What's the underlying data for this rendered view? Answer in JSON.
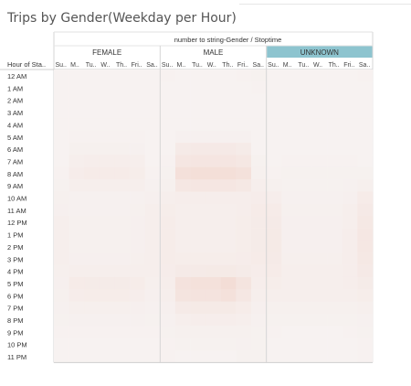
{
  "title": "Trips by Gender(Weekday per Hour)",
  "chart_data": {
    "type": "heatmap",
    "title": "Trips by Gender(Weekday per Hour)",
    "column_header": "number to string-Gender / Stoptime",
    "row_header": "Hour of Sta..",
    "groups": [
      "FEMALE",
      "MALE",
      "UNKNOWN"
    ],
    "highlighted_group": "UNKNOWN",
    "day_labels": [
      "Su..",
      "M..",
      "Tu..",
      "W..",
      "Th..",
      "Fri..",
      "Sa.."
    ],
    "hours": [
      "12 AM",
      "1 AM",
      "2 AM",
      "3 AM",
      "4 AM",
      "5 AM",
      "6 AM",
      "7 AM",
      "8 AM",
      "9 AM",
      "10 AM",
      "11 AM",
      "12 PM",
      "1 PM",
      "2 PM",
      "3 PM",
      "4 PM",
      "5 PM",
      "6 PM",
      "7 PM",
      "8 PM",
      "9 PM",
      "10 PM",
      "11 PM"
    ],
    "color_scale": {
      "low": "#f7f4f4",
      "high": "#efc3b3"
    },
    "intensity": {
      "FEMALE": [
        [
          0.05,
          0.05,
          0.05,
          0.05,
          0.05,
          0.05,
          0.05
        ],
        [
          0.04,
          0.04,
          0.04,
          0.04,
          0.04,
          0.04,
          0.04
        ],
        [
          0.04,
          0.04,
          0.04,
          0.04,
          0.04,
          0.04,
          0.04
        ],
        [
          0.04,
          0.04,
          0.04,
          0.04,
          0.04,
          0.04,
          0.04
        ],
        [
          0.04,
          0.04,
          0.04,
          0.04,
          0.04,
          0.04,
          0.04
        ],
        [
          0.04,
          0.06,
          0.06,
          0.06,
          0.06,
          0.06,
          0.04
        ],
        [
          0.04,
          0.09,
          0.09,
          0.09,
          0.09,
          0.08,
          0.04
        ],
        [
          0.05,
          0.13,
          0.14,
          0.14,
          0.14,
          0.12,
          0.05
        ],
        [
          0.06,
          0.16,
          0.18,
          0.18,
          0.18,
          0.15,
          0.06
        ],
        [
          0.07,
          0.12,
          0.13,
          0.13,
          0.13,
          0.12,
          0.08
        ],
        [
          0.09,
          0.08,
          0.08,
          0.08,
          0.08,
          0.08,
          0.1
        ],
        [
          0.1,
          0.08,
          0.08,
          0.08,
          0.08,
          0.09,
          0.12
        ],
        [
          0.12,
          0.09,
          0.09,
          0.09,
          0.09,
          0.1,
          0.13
        ],
        [
          0.12,
          0.09,
          0.09,
          0.09,
          0.09,
          0.1,
          0.13
        ],
        [
          0.12,
          0.09,
          0.09,
          0.09,
          0.09,
          0.1,
          0.13
        ],
        [
          0.12,
          0.1,
          0.1,
          0.1,
          0.1,
          0.11,
          0.13
        ],
        [
          0.11,
          0.13,
          0.13,
          0.13,
          0.13,
          0.13,
          0.12
        ],
        [
          0.1,
          0.18,
          0.19,
          0.19,
          0.19,
          0.17,
          0.11
        ],
        [
          0.09,
          0.16,
          0.17,
          0.17,
          0.17,
          0.14,
          0.1
        ],
        [
          0.08,
          0.11,
          0.11,
          0.11,
          0.11,
          0.1,
          0.08
        ],
        [
          0.07,
          0.08,
          0.08,
          0.08,
          0.08,
          0.08,
          0.07
        ],
        [
          0.06,
          0.06,
          0.06,
          0.06,
          0.06,
          0.06,
          0.06
        ],
        [
          0.05,
          0.05,
          0.05,
          0.05,
          0.05,
          0.05,
          0.05
        ],
        [
          0.05,
          0.04,
          0.04,
          0.04,
          0.04,
          0.05,
          0.05
        ]
      ],
      "MALE": [
        [
          0.06,
          0.05,
          0.05,
          0.05,
          0.05,
          0.06,
          0.07
        ],
        [
          0.05,
          0.04,
          0.04,
          0.04,
          0.04,
          0.05,
          0.06
        ],
        [
          0.04,
          0.04,
          0.04,
          0.04,
          0.04,
          0.04,
          0.05
        ],
        [
          0.04,
          0.04,
          0.04,
          0.04,
          0.04,
          0.04,
          0.04
        ],
        [
          0.04,
          0.04,
          0.04,
          0.04,
          0.04,
          0.04,
          0.04
        ],
        [
          0.04,
          0.08,
          0.08,
          0.08,
          0.08,
          0.08,
          0.04
        ],
        [
          0.05,
          0.2,
          0.22,
          0.22,
          0.22,
          0.19,
          0.05
        ],
        [
          0.06,
          0.28,
          0.3,
          0.3,
          0.3,
          0.26,
          0.07
        ],
        [
          0.07,
          0.4,
          0.43,
          0.43,
          0.43,
          0.38,
          0.09
        ],
        [
          0.09,
          0.26,
          0.28,
          0.28,
          0.28,
          0.24,
          0.12
        ],
        [
          0.12,
          0.14,
          0.14,
          0.14,
          0.14,
          0.14,
          0.16
        ],
        [
          0.15,
          0.13,
          0.13,
          0.13,
          0.13,
          0.14,
          0.18
        ],
        [
          0.17,
          0.13,
          0.13,
          0.13,
          0.13,
          0.15,
          0.19
        ],
        [
          0.17,
          0.13,
          0.13,
          0.13,
          0.13,
          0.15,
          0.19
        ],
        [
          0.17,
          0.13,
          0.13,
          0.13,
          0.13,
          0.15,
          0.19
        ],
        [
          0.17,
          0.15,
          0.15,
          0.15,
          0.15,
          0.16,
          0.18
        ],
        [
          0.16,
          0.2,
          0.2,
          0.21,
          0.21,
          0.19,
          0.16
        ],
        [
          0.14,
          0.36,
          0.38,
          0.38,
          0.46,
          0.32,
          0.14
        ],
        [
          0.12,
          0.32,
          0.34,
          0.34,
          0.38,
          0.26,
          0.12
        ],
        [
          0.1,
          0.2,
          0.21,
          0.21,
          0.21,
          0.17,
          0.1
        ],
        [
          0.08,
          0.13,
          0.14,
          0.14,
          0.14,
          0.12,
          0.08
        ],
        [
          0.07,
          0.09,
          0.09,
          0.09,
          0.09,
          0.09,
          0.07
        ],
        [
          0.06,
          0.07,
          0.07,
          0.07,
          0.07,
          0.08,
          0.07
        ],
        [
          0.06,
          0.05,
          0.05,
          0.05,
          0.05,
          0.07,
          0.07
        ]
      ],
      "UNKNOWN": [
        [
          0.05,
          0.04,
          0.04,
          0.04,
          0.04,
          0.05,
          0.06
        ],
        [
          0.04,
          0.04,
          0.04,
          0.04,
          0.04,
          0.04,
          0.05
        ],
        [
          0.04,
          0.04,
          0.04,
          0.04,
          0.04,
          0.04,
          0.04
        ],
        [
          0.04,
          0.04,
          0.04,
          0.04,
          0.04,
          0.04,
          0.04
        ],
        [
          0.04,
          0.04,
          0.04,
          0.04,
          0.04,
          0.04,
          0.04
        ],
        [
          0.04,
          0.04,
          0.04,
          0.04,
          0.04,
          0.04,
          0.04
        ],
        [
          0.04,
          0.05,
          0.05,
          0.05,
          0.05,
          0.05,
          0.04
        ],
        [
          0.05,
          0.06,
          0.06,
          0.06,
          0.06,
          0.06,
          0.05
        ],
        [
          0.06,
          0.07,
          0.07,
          0.07,
          0.07,
          0.07,
          0.07
        ],
        [
          0.09,
          0.07,
          0.07,
          0.07,
          0.07,
          0.08,
          0.11
        ],
        [
          0.14,
          0.08,
          0.08,
          0.08,
          0.08,
          0.1,
          0.18
        ],
        [
          0.18,
          0.09,
          0.09,
          0.09,
          0.09,
          0.12,
          0.22
        ],
        [
          0.2,
          0.1,
          0.1,
          0.1,
          0.1,
          0.13,
          0.25
        ],
        [
          0.21,
          0.1,
          0.1,
          0.1,
          0.1,
          0.14,
          0.26
        ],
        [
          0.21,
          0.1,
          0.1,
          0.1,
          0.1,
          0.14,
          0.26
        ],
        [
          0.2,
          0.11,
          0.11,
          0.11,
          0.11,
          0.14,
          0.24
        ],
        [
          0.18,
          0.12,
          0.12,
          0.12,
          0.12,
          0.14,
          0.22
        ],
        [
          0.15,
          0.13,
          0.13,
          0.13,
          0.13,
          0.14,
          0.19
        ],
        [
          0.12,
          0.12,
          0.12,
          0.12,
          0.12,
          0.12,
          0.15
        ],
        [
          0.09,
          0.09,
          0.09,
          0.09,
          0.09,
          0.09,
          0.11
        ],
        [
          0.07,
          0.07,
          0.07,
          0.07,
          0.07,
          0.07,
          0.08
        ],
        [
          0.06,
          0.05,
          0.05,
          0.05,
          0.05,
          0.06,
          0.07
        ],
        [
          0.05,
          0.05,
          0.05,
          0.05,
          0.05,
          0.05,
          0.06
        ],
        [
          0.05,
          0.04,
          0.04,
          0.04,
          0.04,
          0.05,
          0.06
        ]
      ]
    }
  }
}
